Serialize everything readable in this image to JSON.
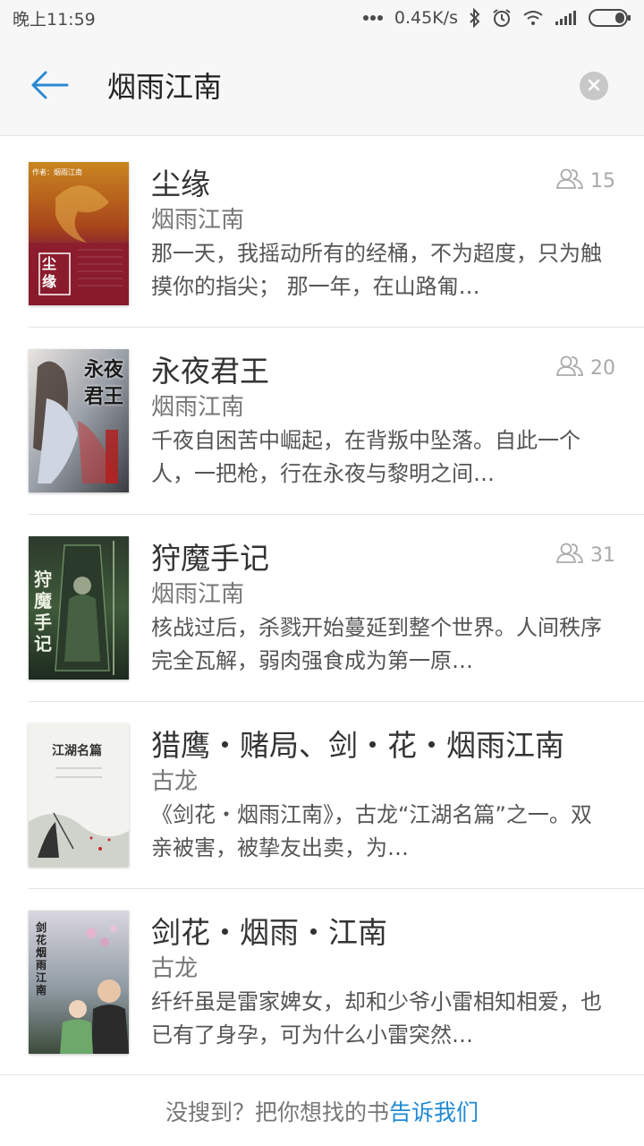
{
  "status_bar": {
    "time": "晚上11:59",
    "network_speed": "0.45K/s"
  },
  "search": {
    "query": "烟雨江南"
  },
  "results": [
    {
      "title": "尘缘",
      "author": "烟雨江南",
      "description": "那一天，我摇动所有的经桶，不为超度，只为触摸你的指尖； 那一年，在山路匍…",
      "readers": "15",
      "cover_text": "尘缘",
      "cover_caption": "作者：烟雨江南"
    },
    {
      "title": "永夜君王",
      "author": "烟雨江南",
      "description": "千夜自困苦中崛起，在背叛中坠落。自此一个人，一把枪，行在永夜与黎明之间…",
      "readers": "20",
      "cover_text": "永夜君王"
    },
    {
      "title": "狩魔手记",
      "author": "烟雨江南",
      "description": "核战过后，杀戮开始蔓延到整个世界。人间秩序完全瓦解，弱肉强食成为第一原…",
      "readers": "31",
      "cover_text": "狩魔手记"
    },
    {
      "title": "猎鹰・赌局、剑・花・烟雨江南",
      "author": "古龙",
      "description": "《剑花・烟雨江南》，古龙“江湖名篇”之一。双亲被害，被挚友出卖，为…",
      "cover_text": "江湖名篇"
    },
    {
      "title": "剑花・烟雨・江南",
      "author": "古龙",
      "description": "纤纤虽是雷家婢女，却和少爷小雷相知相爱，也已有了身孕，可为什么小雷突然…",
      "cover_text": "剑花烟雨江南"
    }
  ],
  "footer": {
    "prompt": "没搜到？把你想找的书",
    "link": "告诉我们"
  }
}
